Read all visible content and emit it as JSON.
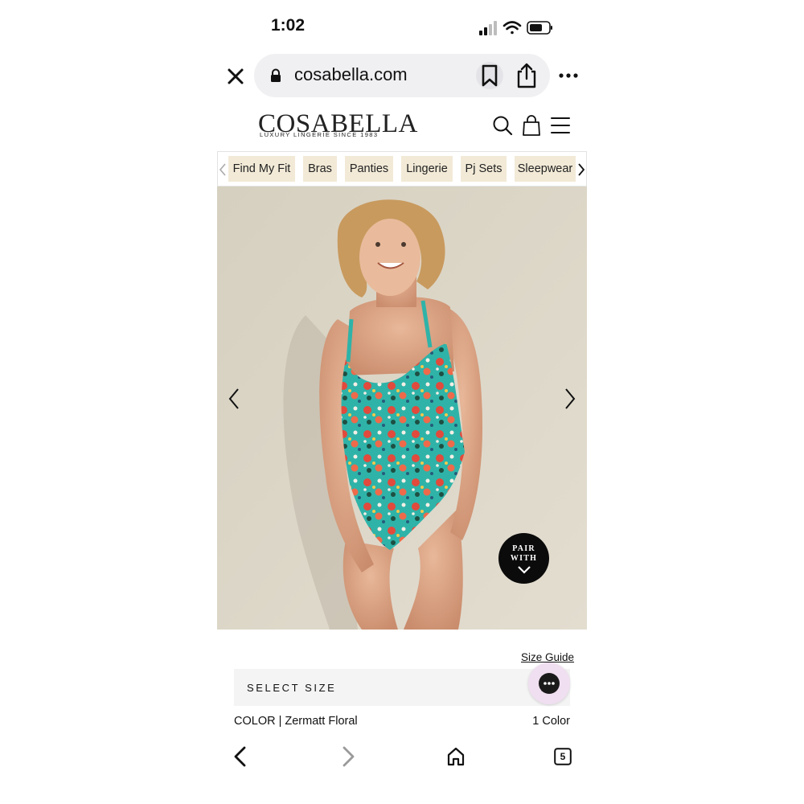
{
  "status_bar": {
    "time": "1:02",
    "icons": [
      "signal-icon",
      "wifi-icon",
      "battery-icon"
    ]
  },
  "browser": {
    "url": "cosabella.com",
    "buttons": [
      "close-icon",
      "lock-icon",
      "bookmark-icon",
      "share-icon",
      "more-icon"
    ]
  },
  "site": {
    "logo_text": "COSABELLA",
    "logo_tagline": "LUXURY LINGERIE SINCE 1983",
    "header_icons": [
      "search-icon",
      "bag-icon",
      "menu-icon"
    ]
  },
  "categories": [
    "Find My Fit",
    "Bras",
    "Panties",
    "Lingerie",
    "Pj Sets",
    "Sleepwear"
  ],
  "hero": {
    "pair_with_line1": "PAIR",
    "pair_with_line2": "WITH"
  },
  "product": {
    "size_guide": "Size Guide",
    "select_size": "SELECT SIZE",
    "color_label": "COLOR | Zermatt Floral",
    "color_count": "1 Color"
  },
  "toolbar": {
    "tabs_count": "5",
    "icons": [
      "back-icon",
      "forward-icon",
      "home-icon",
      "tabs-icon"
    ]
  },
  "colors": {
    "url_bar_bg": "#f0f0f2",
    "chip_bg": "#f2ead7",
    "select_bg": "#f4f4f4",
    "chat_bg": "#f0dff0",
    "hero_bg": "#d9d3c3",
    "swimsuit_teal": "#2fb3a8",
    "swimsuit_red": "#e14a3c"
  }
}
